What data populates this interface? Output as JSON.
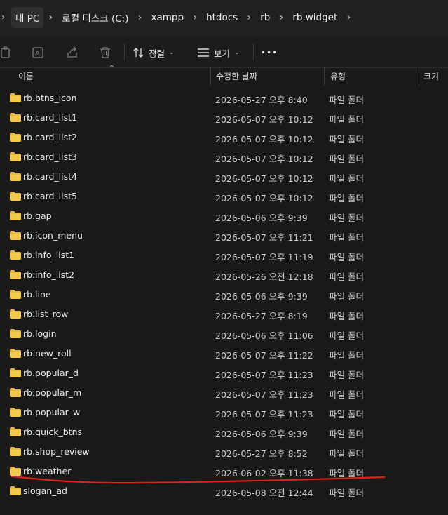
{
  "breadcrumb": {
    "items": [
      "내 PC",
      "로컬 디스크 (C:)",
      "xampp",
      "htdocs",
      "rb",
      "rb.widget"
    ]
  },
  "toolbar": {
    "sort_label": "정렬",
    "view_label": "보기",
    "more_label": "•••"
  },
  "columns": {
    "name": "이름",
    "modified": "수정한 날짜",
    "type": "유형",
    "size": "크기"
  },
  "files": [
    {
      "name": "rb.btns_icon",
      "modified": "2026-05-27 오후 8:40",
      "type": "파일 폴더"
    },
    {
      "name": "rb.card_list1",
      "modified": "2026-05-07 오후 10:12",
      "type": "파일 폴더"
    },
    {
      "name": "rb.card_list2",
      "modified": "2026-05-07 오후 10:12",
      "type": "파일 폴더"
    },
    {
      "name": "rb.card_list3",
      "modified": "2026-05-07 오후 10:12",
      "type": "파일 폴더"
    },
    {
      "name": "rb.card_list4",
      "modified": "2026-05-07 오후 10:12",
      "type": "파일 폴더"
    },
    {
      "name": "rb.card_list5",
      "modified": "2026-05-07 오후 10:12",
      "type": "파일 폴더"
    },
    {
      "name": "rb.gap",
      "modified": "2026-05-06 오후 9:39",
      "type": "파일 폴더"
    },
    {
      "name": "rb.icon_menu",
      "modified": "2026-05-07 오후 11:21",
      "type": "파일 폴더"
    },
    {
      "name": "rb.info_list1",
      "modified": "2026-05-07 오후 11:19",
      "type": "파일 폴더"
    },
    {
      "name": "rb.info_list2",
      "modified": "2026-05-26 오전 12:18",
      "type": "파일 폴더"
    },
    {
      "name": "rb.line",
      "modified": "2026-05-06 오후 9:39",
      "type": "파일 폴더"
    },
    {
      "name": "rb.list_row",
      "modified": "2026-05-27 오후 8:19",
      "type": "파일 폴더"
    },
    {
      "name": "rb.login",
      "modified": "2026-05-06 오후 11:06",
      "type": "파일 폴더"
    },
    {
      "name": "rb.new_roll",
      "modified": "2026-05-07 오후 11:22",
      "type": "파일 폴더"
    },
    {
      "name": "rb.popular_d",
      "modified": "2026-05-07 오후 11:23",
      "type": "파일 폴더"
    },
    {
      "name": "rb.popular_m",
      "modified": "2026-05-07 오후 11:23",
      "type": "파일 폴더"
    },
    {
      "name": "rb.popular_w",
      "modified": "2026-05-07 오후 11:23",
      "type": "파일 폴더"
    },
    {
      "name": "rb.quick_btns",
      "modified": "2026-05-06 오후 9:39",
      "type": "파일 폴더"
    },
    {
      "name": "rb.shop_review",
      "modified": "2026-05-27 오후 8:52",
      "type": "파일 폴더"
    },
    {
      "name": "rb.weather",
      "modified": "2026-06-02 오후 11:38",
      "type": "파일 폴더"
    },
    {
      "name": "slogan_ad",
      "modified": "2026-05-08 오전 12:44",
      "type": "파일 폴더"
    }
  ],
  "annotation": {
    "color": "#e0201b"
  },
  "colors": {
    "folder": "#e8b83c",
    "background": "#191919"
  }
}
